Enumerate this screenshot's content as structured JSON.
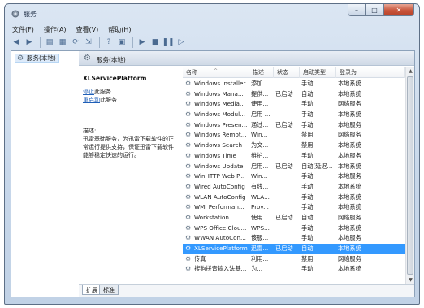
{
  "window": {
    "title": "服务",
    "minimize": "–",
    "maximize": "□",
    "close": "✕"
  },
  "menu": [
    "文件(F)",
    "操作(A)",
    "查看(V)",
    "帮助(H)"
  ],
  "tree": {
    "item": "服务(本地)"
  },
  "header": {
    "label": "服务(本地)"
  },
  "detail": {
    "service_name": "XLServicePlatform",
    "stop_link": "停止",
    "stop_suffix": "此服务",
    "restart_link": "重启动",
    "restart_suffix": "此服务",
    "desc_label": "描述:",
    "desc_text": "迅雷基础服务，为迅雷下载软件的正常运行提供支持，保证迅雷下载软件能够稳定快速的运行。"
  },
  "columns": [
    "名称",
    "描述",
    "状态",
    "启动类型",
    "登录为"
  ],
  "rows": [
    {
      "name": "Windows Installer",
      "desc": "添加...",
      "status": "",
      "startup": "手动",
      "logon": "本地系统"
    },
    {
      "name": "Windows Mana...",
      "desc": "提供...",
      "status": "已启动",
      "startup": "自动",
      "logon": "本地系统"
    },
    {
      "name": "Windows Media...",
      "desc": "使用...",
      "status": "",
      "startup": "手动",
      "logon": "网络服务"
    },
    {
      "name": "Windows Modul...",
      "desc": "启用 ...",
      "status": "",
      "startup": "手动",
      "logon": "本地系统"
    },
    {
      "name": "Windows Presen...",
      "desc": "通过...",
      "status": "已启动",
      "startup": "手动",
      "logon": "本地服务"
    },
    {
      "name": "Windows Remot...",
      "desc": "Win...",
      "status": "",
      "startup": "禁用",
      "logon": "网络服务"
    },
    {
      "name": "Windows Search",
      "desc": "为文...",
      "status": "",
      "startup": "禁用",
      "logon": "本地系统"
    },
    {
      "name": "Windows Time",
      "desc": "维护...",
      "status": "",
      "startup": "手动",
      "logon": "本地服务"
    },
    {
      "name": "Windows Update",
      "desc": "启用...",
      "status": "已启动",
      "startup": "自动(延迟...",
      "logon": "本地系统"
    },
    {
      "name": "WinHTTP Web P...",
      "desc": "Win...",
      "status": "",
      "startup": "手动",
      "logon": "本地服务"
    },
    {
      "name": "Wired AutoConfig",
      "desc": "有线...",
      "status": "",
      "startup": "手动",
      "logon": "本地系统"
    },
    {
      "name": "WLAN AutoConfig",
      "desc": "WLA...",
      "status": "",
      "startup": "手动",
      "logon": "本地系统"
    },
    {
      "name": "WMI Performan...",
      "desc": "Prov...",
      "status": "",
      "startup": "手动",
      "logon": "本地系统"
    },
    {
      "name": "Workstation",
      "desc": "使用 ...",
      "status": "已启动",
      "startup": "自动",
      "logon": "网络服务"
    },
    {
      "name": "WPS Office Clou...",
      "desc": "WPS...",
      "status": "",
      "startup": "手动",
      "logon": "本地系统"
    },
    {
      "name": "WWAN AutoCon...",
      "desc": "该服...",
      "status": "",
      "startup": "手动",
      "logon": "本地服务"
    },
    {
      "name": "XLServicePlatform",
      "desc": "迅雷...",
      "status": "已启动",
      "startup": "自动",
      "logon": "本地系统",
      "selected": true
    },
    {
      "name": "传真",
      "desc": "利用...",
      "status": "",
      "startup": "禁用",
      "logon": "网络服务"
    },
    {
      "name": "搜狗拼音输入法基...",
      "desc": "为...",
      "status": "",
      "startup": "手动",
      "logon": "本地系统"
    }
  ],
  "tabs": [
    "扩展",
    "标准"
  ],
  "colors": {
    "selection": "#3399ff",
    "link": "#1f5fb7",
    "frame": "#c7d7ea"
  }
}
